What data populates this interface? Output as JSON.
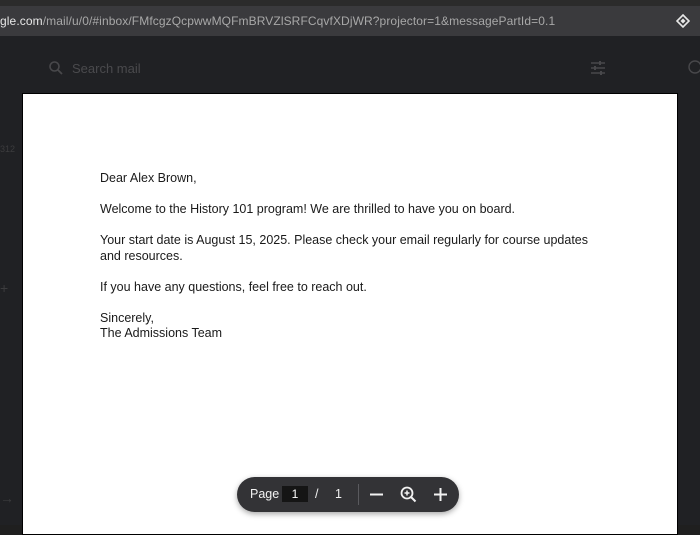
{
  "browser": {
    "url_visible_prefix": "gle.com",
    "url_visible_rest": "/mail/u/0/#inbox/FMfcgzQcpwwMQFmBRVZlSRFCqvfXDjWR?projector=1&messagePartId=0.1"
  },
  "gmail": {
    "search_placeholder": "Search mail",
    "left_peek_text": "312",
    "left_plus": "+",
    "left_arrow": "→"
  },
  "document": {
    "greeting": "Dear Alex Brown,",
    "paragraph1": "Welcome to the History 101 program! We are thrilled to have you on board.",
    "paragraph2": "Your start date is August 15, 2025. Please check your email regularly for course updates and resources.",
    "paragraph3": "If you have any questions, feel free to reach out.",
    "closing": "Sincerely,",
    "signature": "The Admissions Team"
  },
  "pager": {
    "page_label": "Page",
    "current_page": "1",
    "separator": "/",
    "total_pages": "1"
  },
  "icons": {
    "search": "search-icon",
    "tune": "tune-icon",
    "help": "help-icon",
    "extension": "extension-icon",
    "zoom_out": "minus-icon",
    "zoom_reset": "zoom-icon",
    "zoom_in": "plus-icon"
  },
  "colors": {
    "url_bar_bg": "#3a3a3d",
    "app_bg": "#202124",
    "pager_bg": "#333336",
    "document_bg": "#ffffff"
  }
}
